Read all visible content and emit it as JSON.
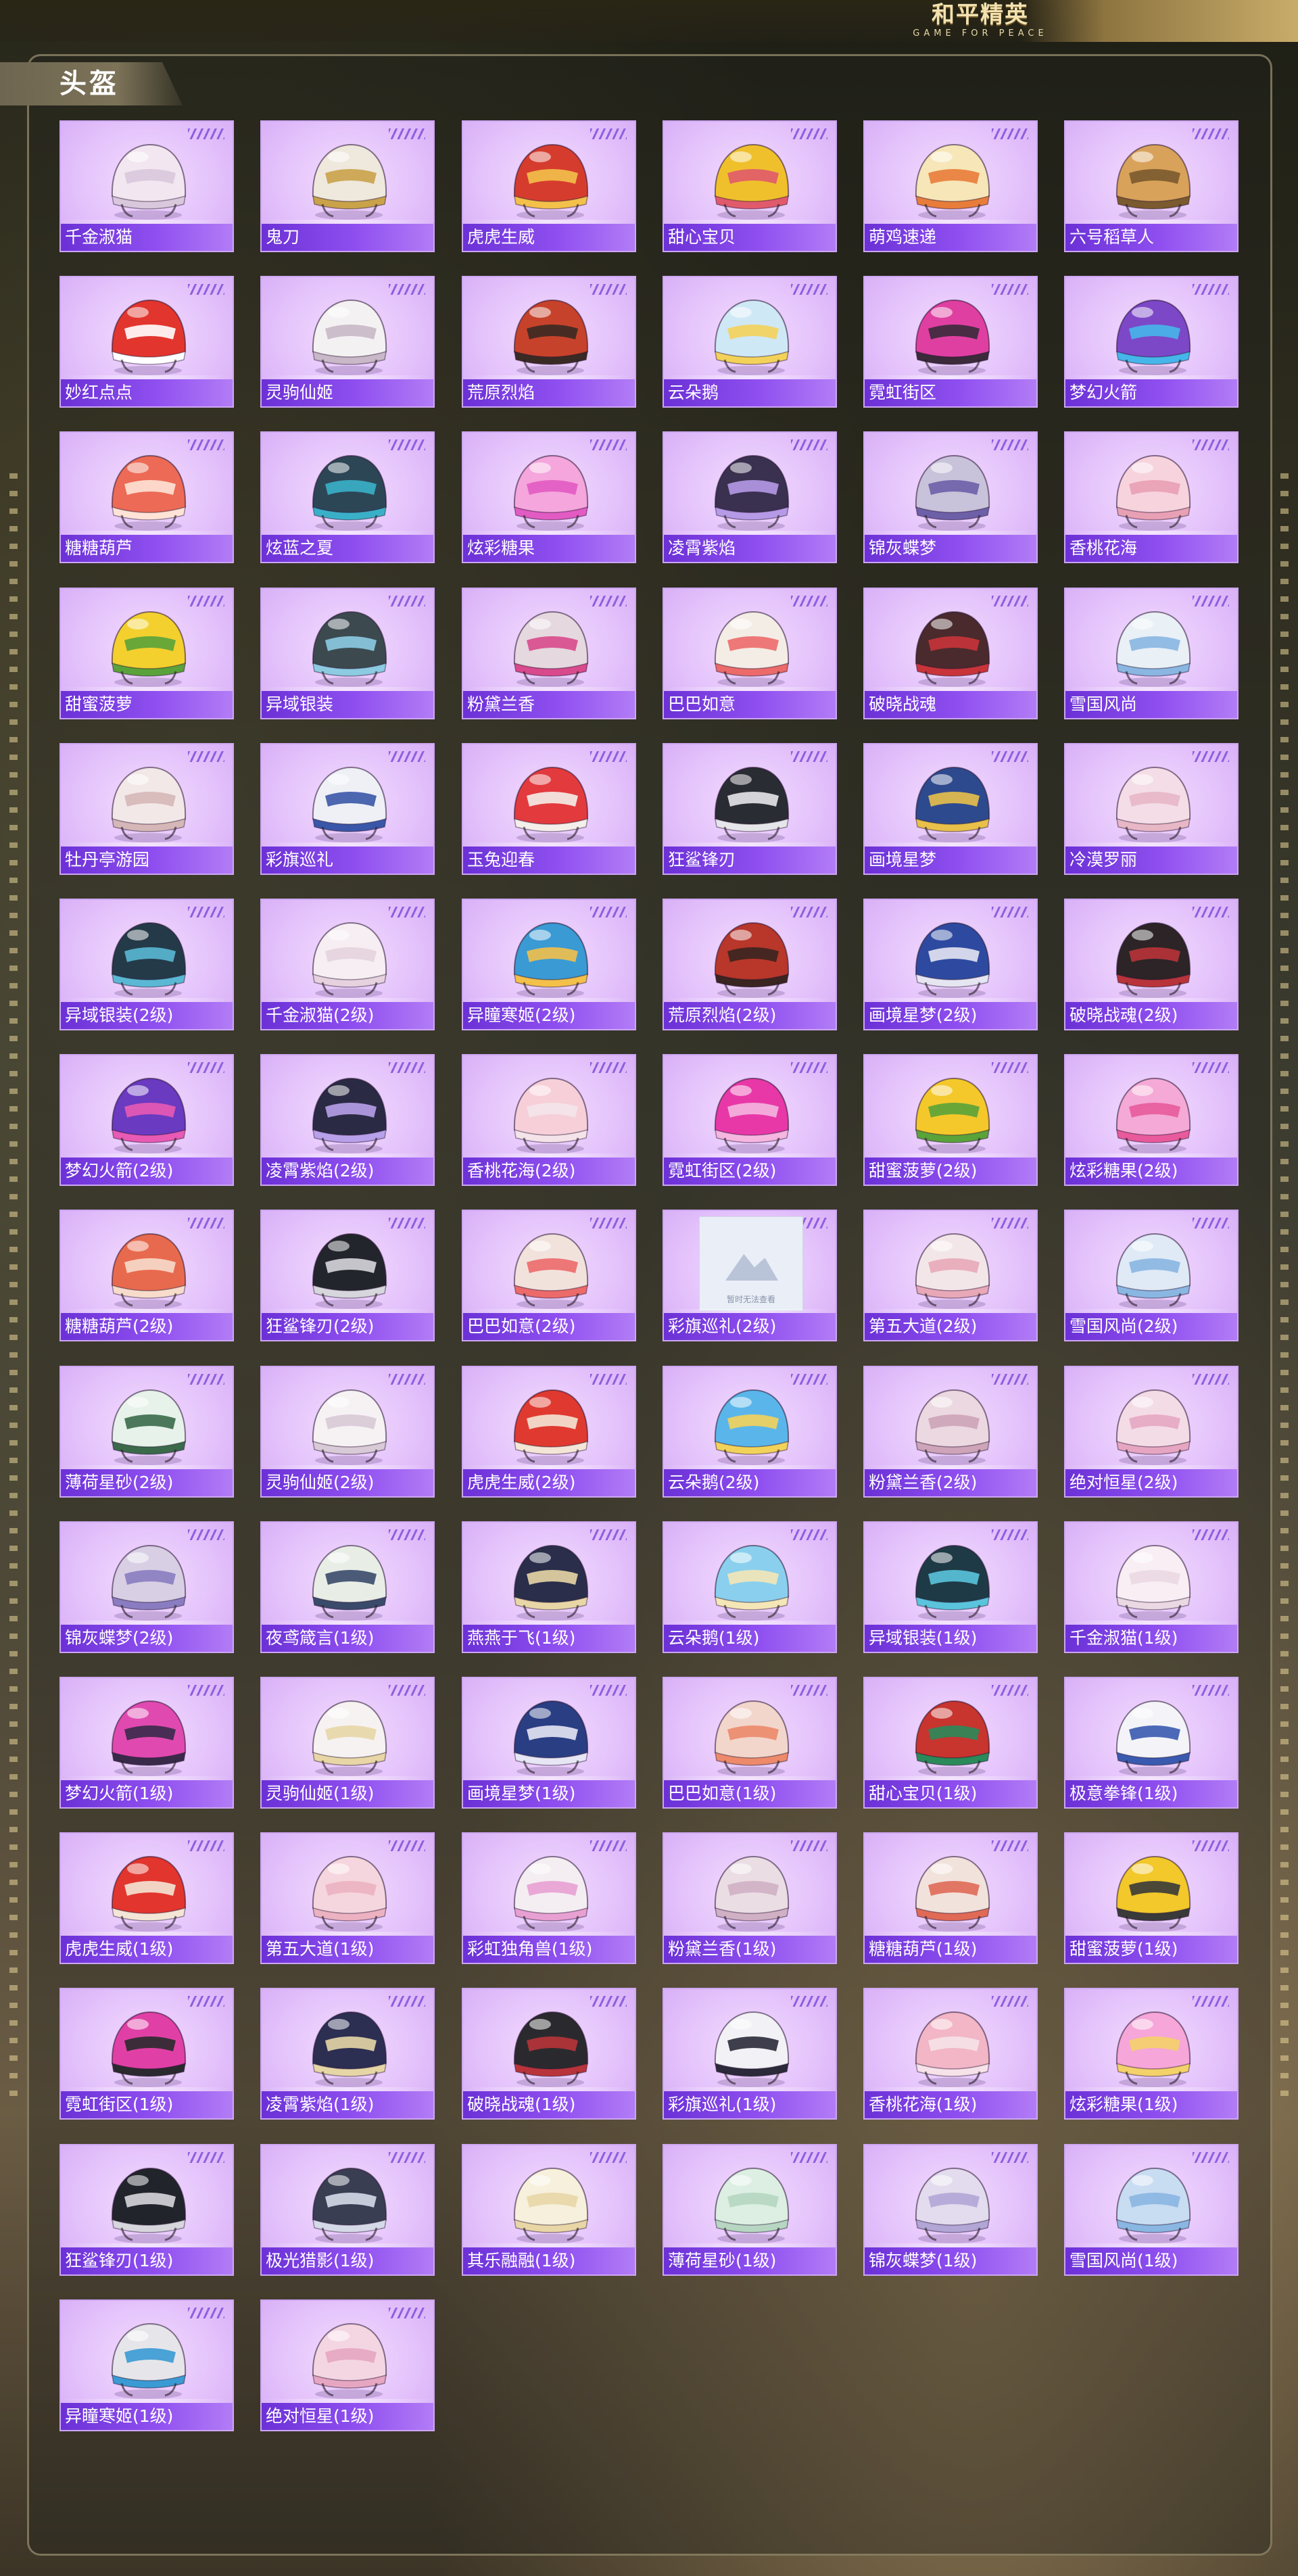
{
  "header": {
    "logo_cn": "和平精英",
    "logo_en": "GAME FOR PEACE"
  },
  "section": {
    "title": "头盔"
  },
  "placeholder_text": "暂时无法查看",
  "helmets": [
    {
      "name": "千金淑猫",
      "color": "#f2e6f0",
      "accent": "#d9c7dc"
    },
    {
      "name": "鬼刀",
      "color": "#efe8dd",
      "accent": "#c9a24a"
    },
    {
      "name": "虎虎生威",
      "color": "#d63c2e",
      "accent": "#f3c04a"
    },
    {
      "name": "甜心宝贝",
      "color": "#f0c02c",
      "accent": "#e05a6c"
    },
    {
      "name": "萌鸡速递",
      "color": "#f7e6b8",
      "accent": "#e87c3a"
    },
    {
      "name": "六号稻草人",
      "color": "#d9a25a",
      "accent": "#7a5a2e"
    },
    {
      "name": "妙红点点",
      "color": "#e2352e",
      "accent": "#ffffff"
    },
    {
      "name": "灵驹仙姬",
      "color": "#f4f1f2",
      "accent": "#c9b8c8"
    },
    {
      "name": "荒原烈焰",
      "color": "#c7422a",
      "accent": "#3a2a24"
    },
    {
      "name": "云朵鹅",
      "color": "#cfe8f6",
      "accent": "#f3d25a"
    },
    {
      "name": "霓虹街区",
      "color": "#e03fa2",
      "accent": "#3a2a3a"
    },
    {
      "name": "梦幻火箭",
      "color": "#7c48c8",
      "accent": "#46b6ea"
    },
    {
      "name": "糖糖葫芦",
      "color": "#ec6a56",
      "accent": "#ffe3d6"
    },
    {
      "name": "炫蓝之夏",
      "color": "#2c4656",
      "accent": "#3ab0c8"
    },
    {
      "name": "炫彩糖果",
      "color": "#f5a6dc",
      "accent": "#e25bc3"
    },
    {
      "name": "凌霄紫焰",
      "color": "#3a3050",
      "accent": "#b59ae6"
    },
    {
      "name": "锦灰蝶梦",
      "color": "#c8c2da",
      "accent": "#6d5fa8"
    },
    {
      "name": "香桃花海",
      "color": "#f7d3de",
      "accent": "#e8a0b4"
    },
    {
      "name": "甜蜜菠萝",
      "color": "#f3d02e",
      "accent": "#5aa23a"
    },
    {
      "name": "异域银装",
      "color": "#3c4a50",
      "accent": "#8ccbe2"
    },
    {
      "name": "粉黛兰香",
      "color": "#e5d8de",
      "accent": "#d84a8c"
    },
    {
      "name": "巴巴如意",
      "color": "#f3ede6",
      "accent": "#ec6a6a"
    },
    {
      "name": "破晓战魂",
      "color": "#4a2a2c",
      "accent": "#c8343a"
    },
    {
      "name": "雪国风尚",
      "color": "#e9f0f6",
      "accent": "#8ab6e2"
    },
    {
      "name": "牡丹亭游园",
      "color": "#f3e8e8",
      "accent": "#d6b7b7"
    },
    {
      "name": "彩旗巡礼",
      "color": "#eef0f6",
      "accent": "#3a56a8"
    },
    {
      "name": "玉兔迎春",
      "color": "#e33a3e",
      "accent": "#f4efea"
    },
    {
      "name": "狂鲨锋刃",
      "color": "#2a2c34",
      "accent": "#e6e6ea"
    },
    {
      "name": "画境星梦",
      "color": "#2e4a8e",
      "accent": "#e8c04a"
    },
    {
      "name": "冷漠罗丽",
      "color": "#f4dde6",
      "accent": "#e8b7c6"
    },
    {
      "name": "异域银装(2级)",
      "color": "#243a48",
      "accent": "#5ab8d4"
    },
    {
      "name": "千金淑猫(2级)",
      "color": "#f6eef2",
      "accent": "#e6d2de"
    },
    {
      "name": "异瞳寒姬(2级)",
      "color": "#3a9ad4",
      "accent": "#f3c04a"
    },
    {
      "name": "荒原烈焰(2级)",
      "color": "#b8362a",
      "accent": "#3a2520"
    },
    {
      "name": "画境星梦(2级)",
      "color": "#2e4aa0",
      "accent": "#e6e6f2"
    },
    {
      "name": "破晓战魂(2级)",
      "color": "#2c2426",
      "accent": "#b8343a"
    },
    {
      "name": "梦幻火箭(2级)",
      "color": "#6a3ac0",
      "accent": "#e85ab4"
    },
    {
      "name": "凌霄紫焰(2级)",
      "color": "#2a2a44",
      "accent": "#b8a0ea"
    },
    {
      "name": "香桃花海(2级)",
      "color": "#f6cfd8",
      "accent": "#f4e4ea"
    },
    {
      "name": "霓虹街区(2级)",
      "color": "#e838a8",
      "accent": "#f5b6e0"
    },
    {
      "name": "甜蜜菠萝(2级)",
      "color": "#f4c82a",
      "accent": "#5aa23a"
    },
    {
      "name": "炫彩糖果(2级)",
      "color": "#f5a9d6",
      "accent": "#e85a9c"
    },
    {
      "name": "糖糖葫芦(2级)",
      "color": "#e86a4e",
      "accent": "#f7dccc"
    },
    {
      "name": "狂鲨锋刃(2级)",
      "color": "#23252c",
      "accent": "#d6d6dc"
    },
    {
      "name": "巴巴如意(2级)",
      "color": "#f2e2dc",
      "accent": "#ec6a6a"
    },
    {
      "name": "彩旗巡礼(2级)",
      "color": "#eeeeee",
      "accent": "#cccccc",
      "placeholder": true
    },
    {
      "name": "第五大道(2级)",
      "color": "#f3e6e8",
      "accent": "#e8a8b8"
    },
    {
      "name": "雪国风尚(2级)",
      "color": "#dfeaf6",
      "accent": "#8ab6e2"
    },
    {
      "name": "薄荷星砂(2级)",
      "color": "#e6f2ea",
      "accent": "#3a6a4a"
    },
    {
      "name": "灵驹仙姬(2级)",
      "color": "#f6f2f4",
      "accent": "#d8cad6"
    },
    {
      "name": "虎虎生威(2级)",
      "color": "#e03a30",
      "accent": "#f4e6d6"
    },
    {
      "name": "云朵鹅(2级)",
      "color": "#5ab6ea",
      "accent": "#f3d25a"
    },
    {
      "name": "粉黛兰香(2级)",
      "color": "#ecd8e0",
      "accent": "#cda4b8"
    },
    {
      "name": "绝对恒星(2级)",
      "color": "#f4dce6",
      "accent": "#e6a6c2"
    },
    {
      "name": "锦灰蝶梦(2级)",
      "color": "#d8cfe4",
      "accent": "#8a7cc0"
    },
    {
      "name": "夜鸢箴言(1级)",
      "color": "#e8eee6",
      "accent": "#3a4a6a"
    },
    {
      "name": "燕燕于飞(1级)",
      "color": "#2a2e4a",
      "accent": "#e8d6a6"
    },
    {
      "name": "云朵鹅(1级)",
      "color": "#8ad0ee",
      "accent": "#f4e6b6"
    },
    {
      "name": "异域银装(1级)",
      "color": "#1e3a46",
      "accent": "#5ac4dc"
    },
    {
      "name": "千金淑猫(1级)",
      "color": "#f8eef4",
      "accent": "#ead8e2"
    },
    {
      "name": "梦幻火箭(1级)",
      "color": "#e04ab0",
      "accent": "#3a2a4a"
    },
    {
      "name": "灵驹仙姬(1级)",
      "color": "#f6f2f2",
      "accent": "#e8d6a6"
    },
    {
      "name": "画境星梦(1级)",
      "color": "#2a3e84",
      "accent": "#e6e6f4"
    },
    {
      "name": "巴巴如意(1级)",
      "color": "#f2d6cc",
      "accent": "#ec8a6a"
    },
    {
      "name": "甜心宝贝(1级)",
      "color": "#c8342e",
      "accent": "#2a8a5a"
    },
    {
      "name": "极意拳锋(1级)",
      "color": "#f4f4f8",
      "accent": "#3a5ab0"
    },
    {
      "name": "虎虎生威(1级)",
      "color": "#e2352e",
      "accent": "#f4e6d6"
    },
    {
      "name": "第五大道(1级)",
      "color": "#f6d6de",
      "accent": "#ecb2c2"
    },
    {
      "name": "彩虹独角兽(1级)",
      "color": "#f4eef2",
      "accent": "#e8a0d2"
    },
    {
      "name": "粉黛兰香(1级)",
      "color": "#eadde4",
      "accent": "#d0b0c4"
    },
    {
      "name": "糖糖葫芦(1级)",
      "color": "#f2e2dc",
      "accent": "#e06a56"
    },
    {
      "name": "甜蜜菠萝(1级)",
      "color": "#f2c82a",
      "accent": "#3a3a3a"
    },
    {
      "name": "霓虹街区(1级)",
      "color": "#e040a6",
      "accent": "#2a2a2e"
    },
    {
      "name": "凌霄紫焰(1级)",
      "color": "#2c2e52",
      "accent": "#e6d6a6"
    },
    {
      "name": "破晓战魂(1级)",
      "color": "#2a2a2e",
      "accent": "#b8343a"
    },
    {
      "name": "彩旗巡礼(1级)",
      "color": "#f2f2f6",
      "accent": "#2a2a3a"
    },
    {
      "name": "香桃花海(1级)",
      "color": "#f2b6c6",
      "accent": "#f6e2e8"
    },
    {
      "name": "炫彩糖果(1级)",
      "color": "#f6a6d8",
      "accent": "#f4d26a"
    },
    {
      "name": "狂鲨锋刃(1级)",
      "color": "#22242c",
      "accent": "#d6d6dc"
    },
    {
      "name": "极光猎影(1级)",
      "color": "#3a3e52",
      "accent": "#d6dae8"
    },
    {
      "name": "其乐融融(1级)",
      "color": "#f6f0dc",
      "accent": "#e8d6a6"
    },
    {
      "name": "薄荷星砂(1级)",
      "color": "#dcefe2",
      "accent": "#b6d6c2"
    },
    {
      "name": "锦灰蝶梦(1级)",
      "color": "#e2dcee",
      "accent": "#b2a6d6"
    },
    {
      "name": "雪国风尚(1级)",
      "color": "#c8dcf2",
      "accent": "#8ab6e2"
    },
    {
      "name": "异瞳寒姬(1级)",
      "color": "#e6e6ea",
      "accent": "#3a9ad4"
    },
    {
      "name": "绝对恒星(1级)",
      "color": "#f4d6e2",
      "accent": "#e6a6c2"
    }
  ]
}
